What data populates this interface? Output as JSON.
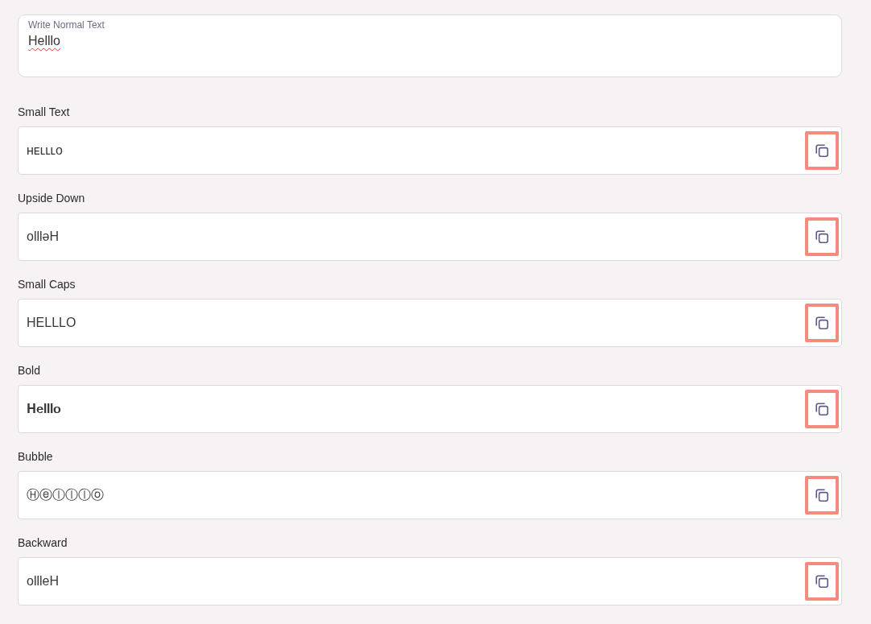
{
  "input": {
    "label": "Write Normal Text",
    "value": "Helllo",
    "misspelled": true
  },
  "styles": [
    {
      "name": "Small Text",
      "output": "ʜᴇʟʟʟᴏ"
    },
    {
      "name": "Upside Down",
      "output": "olllǝH"
    },
    {
      "name": "Small Caps",
      "output": "HELLLO"
    },
    {
      "name": "Bold",
      "output": "𝐇𝐞𝐥𝐥𝐥𝐨"
    },
    {
      "name": "Bubble",
      "output": "Ⓗⓔⓛⓛⓛⓞ"
    },
    {
      "name": "Backward",
      "output": "olllеH"
    }
  ]
}
